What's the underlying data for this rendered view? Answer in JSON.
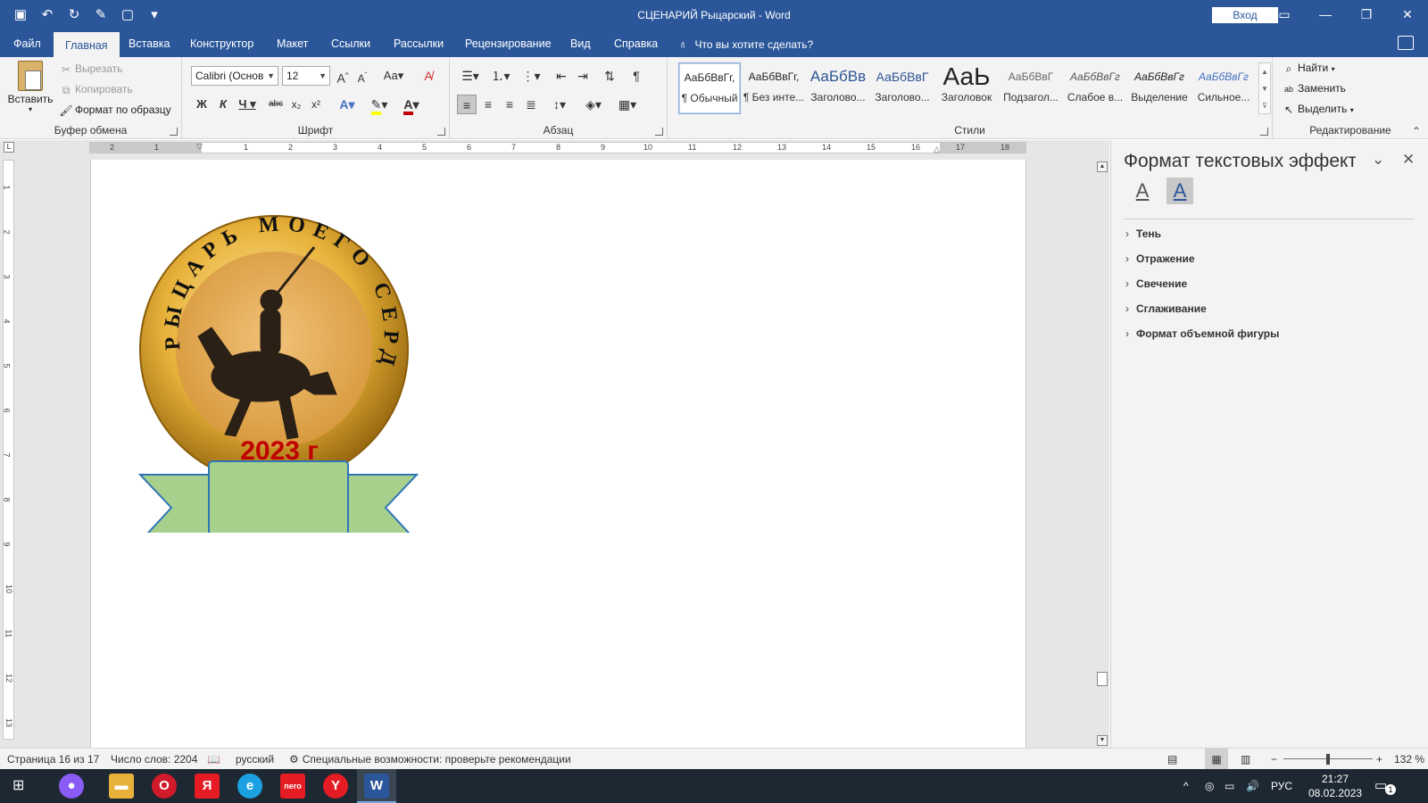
{
  "titlebar": {
    "document_title": "СЦЕНАРИЙ Рыцарский  -  Word",
    "signin_label": "Вход"
  },
  "menu": {
    "tabs": [
      "Файл",
      "Главная",
      "Вставка",
      "Конструктор",
      "Макет",
      "Ссылки",
      "Рассылки",
      "Рецензирование",
      "Вид",
      "Справка"
    ],
    "active_tab": "Главная",
    "tell_me": "Что вы хотите сделать?"
  },
  "ribbon": {
    "clipboard": {
      "paste": "Вставить",
      "cut": "Вырезать",
      "copy": "Копировать",
      "format_painter": "Формат по образцу",
      "label": "Буфер обмена"
    },
    "font": {
      "name": "Calibri (Основ",
      "size": "12",
      "label": "Шрифт"
    },
    "paragraph": {
      "label": "Абзац"
    },
    "styles": {
      "label": "Стили",
      "items": [
        {
          "preview": "АаБбВвГг,",
          "name": "¶ Обычный"
        },
        {
          "preview": "АаБбВвГг,",
          "name": "¶ Без инте..."
        },
        {
          "preview": "АаБбВв",
          "name": "Заголово..."
        },
        {
          "preview": "АаБбВвГ",
          "name": "Заголово..."
        },
        {
          "preview": "АаЬ",
          "name": "Заголовок"
        },
        {
          "preview": "АаБбВвГ",
          "name": "Подзагол..."
        },
        {
          "preview": "АаБбВвГг",
          "name": "Слабое в..."
        },
        {
          "preview": "АаБбВвГг",
          "name": "Выделение"
        },
        {
          "preview": "АаБбВвГг",
          "name": "Сильное..."
        }
      ]
    },
    "editing": {
      "find": "Найти",
      "replace": "Заменить",
      "select": "Выделить",
      "label": "Редактирование"
    }
  },
  "ruler": {
    "h_numbers": [
      "2",
      "1",
      "1",
      "2",
      "3",
      "4",
      "5",
      "6",
      "7",
      "8",
      "9",
      "10",
      "11",
      "12",
      "13",
      "14",
      "15",
      "16",
      "17",
      "18"
    ],
    "v_numbers": [
      "1",
      "2",
      "3",
      "4",
      "5",
      "6",
      "7",
      "8",
      "9",
      "10",
      "11",
      "12",
      "13"
    ]
  },
  "document": {
    "emblem_text": "РЫЦАРЬ МОЕГО СЕРДЦА",
    "ribbon_text": "2023 г",
    "colors": {
      "gold": "#e8b23a",
      "ribbon_green": "#a8d08d",
      "ribbon_border": "#2e75b6",
      "year_red": "#c00000"
    }
  },
  "pane": {
    "title": "Формат текстовых эффектов",
    "sections": [
      "Тень",
      "Отражение",
      "Свечение",
      "Сглаживание",
      "Формат объемной фигуры"
    ]
  },
  "status": {
    "page": "Страница 16 из 17",
    "words": "Число слов: 2204",
    "language": "русский",
    "accessibility": "Специальные возможности: проверьте рекомендации",
    "zoom": "132 %"
  },
  "taskbar": {
    "lang": "РУС",
    "time": "21:27",
    "date": "08.02.2023",
    "notifications": "1"
  }
}
